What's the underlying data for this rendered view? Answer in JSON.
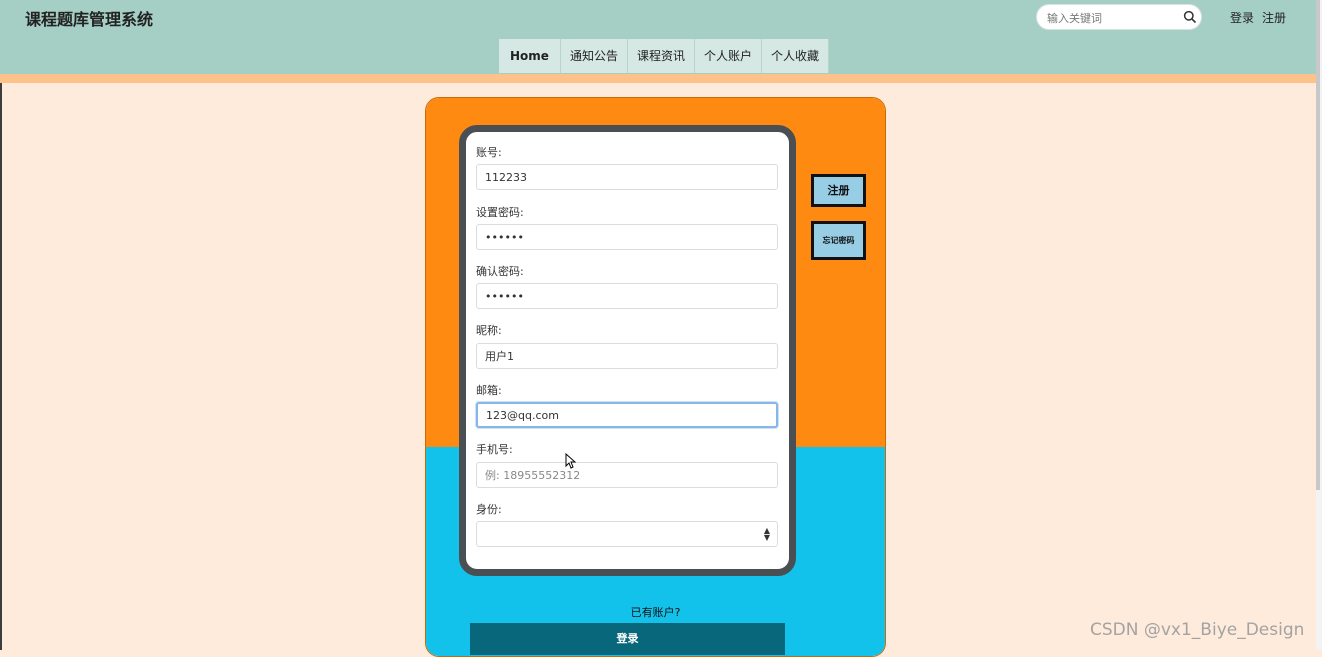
{
  "header": {
    "site_title": "课程题库管理系统",
    "search_placeholder": "输入关键词",
    "login_link": "登录",
    "register_link": "注册"
  },
  "nav": {
    "items": [
      "Home",
      "通知公告",
      "课程资讯",
      "个人账户",
      "个人收藏"
    ]
  },
  "form": {
    "account_label": "账号:",
    "account_value": "112233",
    "password_label": "设置密码:",
    "password_value": "••••••",
    "confirm_label": "确认密码:",
    "confirm_value": "••••••",
    "nickname_label": "昵称:",
    "nickname_value": "用户1",
    "email_label": "邮箱:",
    "email_value": "123@qq.com",
    "phone_label": "手机号:",
    "phone_placeholder": "例: 18955552312",
    "identity_label": "身份:",
    "identity_value": ""
  },
  "side_buttons": {
    "register": "注册",
    "forgot_password": "忘记密码"
  },
  "footer": {
    "have_account": "已有账户?",
    "login_button": "登录"
  },
  "watermark": "CSDN @vx1_Biye_Design",
  "colors": {
    "header_bg": "#a5cfc4",
    "page_bg": "#ffebdb",
    "panel_orange": "#fe8a11",
    "panel_blue": "#13c2eb",
    "login_button_bg": "#08677a",
    "side_button_bg": "#98cde6"
  }
}
